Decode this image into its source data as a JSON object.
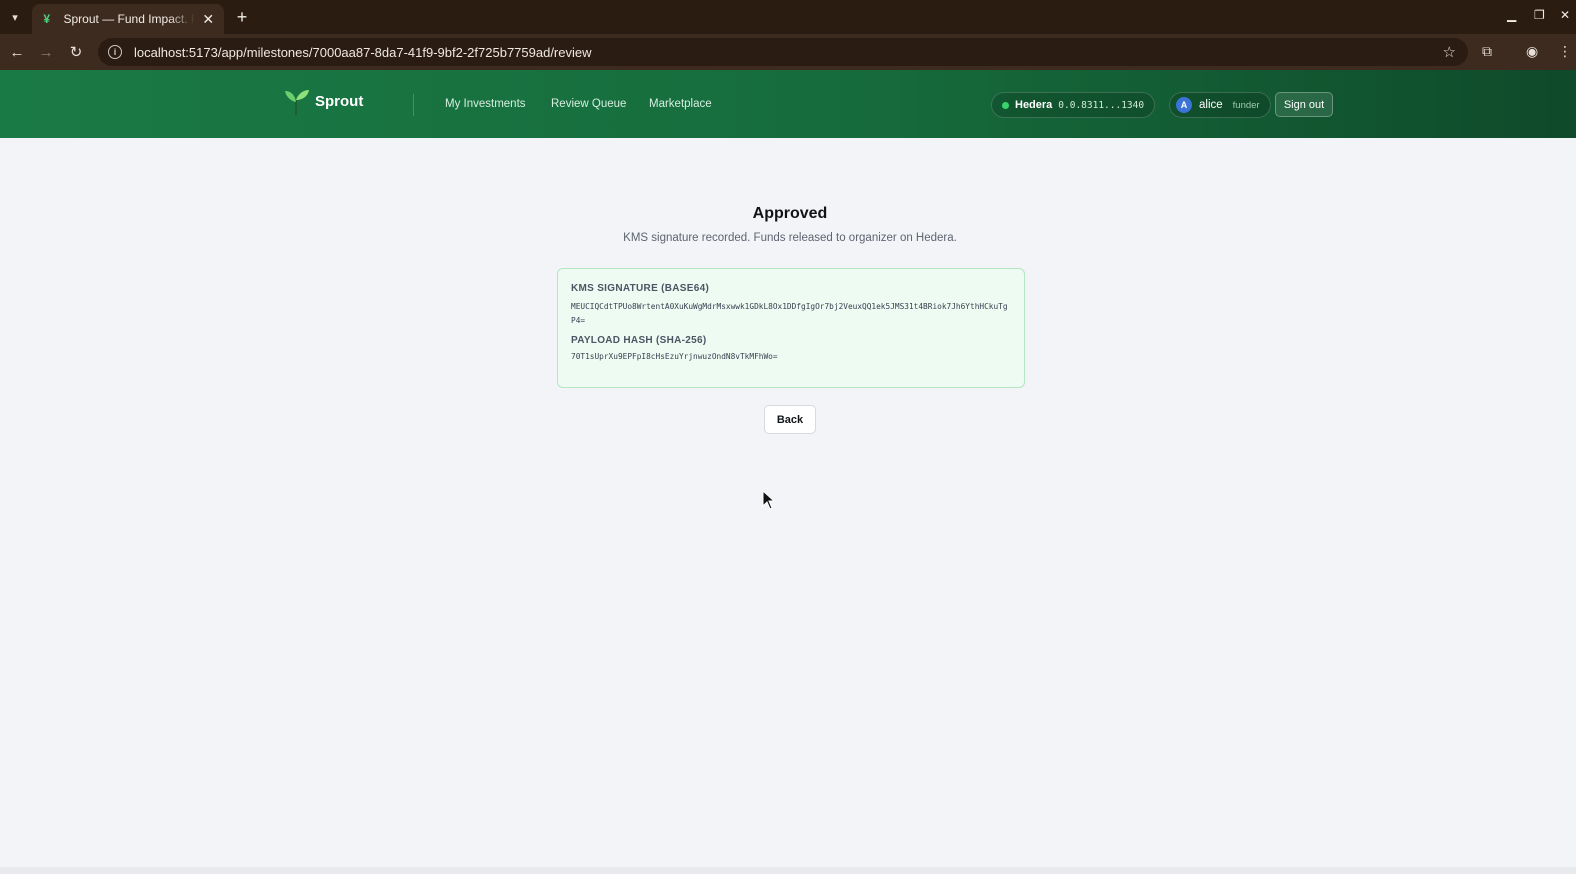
{
  "browser": {
    "tab_title": "Sprout — Fund Impact. Rel",
    "url": "localhost:5173/app/milestones/7000aa87-8da7-41f9-9bf2-2f725b7759ad/review"
  },
  "header": {
    "brand": "Sprout",
    "nav": [
      "My Investments",
      "Review Queue",
      "Marketplace"
    ],
    "network": {
      "label": "Hedera",
      "account": "0.0.8311...1340",
      "status_color": "#38d46a"
    },
    "user": {
      "initial": "A",
      "name": "alice",
      "role": "funder"
    },
    "signout_label": "Sign out"
  },
  "main": {
    "title": "Approved",
    "subtitle": "KMS signature recorded. Funds released to organizer on Hedera.",
    "signature_label": "KMS SIGNATURE (BASE64)",
    "signature_value": "MEUCIQCdtTPUo8WrtentA0XuKuWgMdrMsxwwk1GDkL8Ox1DDfgIgOr7bj2VeuxQQ1ek5JMS31t4BRiok7Jh6YthHCkuTgP4=",
    "hash_label": "PAYLOAD HASH (SHA-256)",
    "hash_value": "70T1sUprXu9EPFpI8cHsEzuYrjnwuzOndN8vTkMFhWo=",
    "back_label": "Back"
  },
  "colors": {
    "header_green": "#1a7a45",
    "card_bg": "#eefbf2",
    "card_border": "#b5e6c4"
  }
}
